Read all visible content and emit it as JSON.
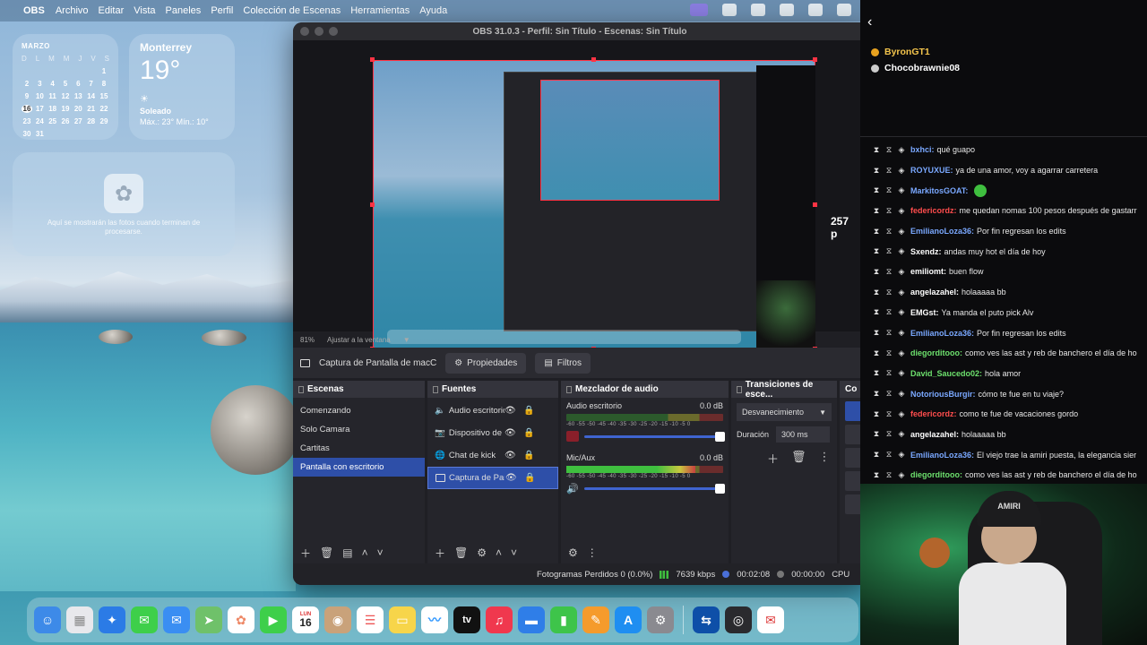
{
  "menubar": {
    "apple": "",
    "app_name": "OBS",
    "items": [
      "Archivo",
      "Editar",
      "Vista",
      "Paneles",
      "Perfil",
      "Colección de Escenas",
      "Herramientas",
      "Ayuda"
    ]
  },
  "calendar_widget": {
    "month": "MARZO",
    "weekdays": [
      "D",
      "L",
      "M",
      "M",
      "J",
      "V",
      "S"
    ],
    "weeks": [
      [
        "",
        "",
        "",
        "",
        "",
        "",
        "1"
      ],
      [
        "2",
        "3",
        "4",
        "5",
        "6",
        "7",
        "8"
      ],
      [
        "9",
        "10",
        "11",
        "12",
        "13",
        "14",
        "15"
      ],
      [
        "16",
        "17",
        "18",
        "19",
        "20",
        "21",
        "22"
      ],
      [
        "23",
        "24",
        "25",
        "26",
        "27",
        "28",
        "29"
      ],
      [
        "30",
        "31",
        "",
        "",
        "",
        "",
        ""
      ]
    ],
    "today": "16"
  },
  "weather_widget": {
    "city": "Monterrey",
    "temp": "19°",
    "condition": "Soleado",
    "range": "Máx.: 23° Mín.: 10°"
  },
  "photos_widget": {
    "text": "Aquí se mostrarán las fotos cuando terminan de procesarse."
  },
  "obs": {
    "title": "OBS 31.0.3 - Perfil: Sin Título - Escenas: Sin Título",
    "preview_overlay_number": "257 p",
    "zoom": {
      "percent": "81%",
      "fit_label": "Ajustar a la ventana"
    },
    "source_toolbar": {
      "source_name": "Captura de Pantalla de macC",
      "properties": "Propiedades",
      "filters": "Filtros"
    },
    "scenes": {
      "title": "Escenas",
      "items": [
        "Comenzando",
        "Solo Camara",
        "Cartitas",
        "Pantalla con escritorio"
      ],
      "selected_index": 3
    },
    "sources": {
      "title": "Fuentes",
      "items": [
        {
          "label": "Audio escritorio",
          "icon": "speaker-icon"
        },
        {
          "label": "Dispositivo de c",
          "icon": "camera-icon"
        },
        {
          "label": "Chat de kick",
          "icon": "browser-icon"
        },
        {
          "label": "Captura de Pan",
          "icon": "monitor-icon"
        }
      ],
      "selected_index": 3
    },
    "mixer": {
      "title": "Mezclador de audio",
      "scale": "-60 -55 -50 -45 -40 -35 -30 -25 -20 -15 -10 -5 0",
      "channels": [
        {
          "name": "Audio escritorio",
          "db": "0.0 dB",
          "level": 0,
          "muted": true
        },
        {
          "name": "Mic/Aux",
          "db": "0.0 dB",
          "level": 0.82,
          "muted": false
        }
      ]
    },
    "transitions": {
      "title": "Transiciones de esce...",
      "type": "Desvanecimiento",
      "duration_label": "Duración",
      "duration_value": "300 ms"
    },
    "controls": {
      "title": "Co"
    },
    "status": {
      "dropped": "Fotogramas Perdidos 0 (0.0%)",
      "bitrate": "7639 kbps",
      "stream_time": "00:02:08",
      "rec_time": "00:00:00",
      "cpu": "CPU"
    }
  },
  "dock": {
    "calendar_day": "16",
    "calendar_month": "LUN",
    "apps": [
      "finder-icon",
      "launchpad-icon",
      "safari-icon",
      "messages-icon",
      "mail-icon",
      "maps-icon",
      "photos-icon",
      "facetime-icon",
      "calendar-icon",
      "contacts-icon",
      "reminders-icon",
      "notes-icon",
      "freeform-icon",
      "appletv-icon",
      "music-icon",
      "keynote-icon",
      "numbers-icon",
      "pages-icon",
      "appstore-icon",
      "settings-icon",
      "teamviewer-icon",
      "obs-icon",
      "airmail-icon"
    ]
  },
  "chat": {
    "pinned": [
      {
        "user": "ByronGT1",
        "color": "#f3c44c"
      },
      {
        "user": "Chocobrawnie08",
        "color": "#ffffff"
      }
    ],
    "messages": [
      {
        "user": "bxhci",
        "color": "#7aa8ff",
        "text": "qué guapo",
        "emote": false
      },
      {
        "user": "ROYUXUE",
        "color": "#7aa8ff",
        "text": "ya de una amor, voy a agarrar carretera",
        "emote": false
      },
      {
        "user": "MarkitosGOAT",
        "color": "#7aa8ff",
        "text": "",
        "emote": true
      },
      {
        "user": "federicordz",
        "color": "#ff4d4d",
        "text": "me quedan nomas 100 pesos después de gastarr",
        "emote": false
      },
      {
        "user": "EmilianoLoza36",
        "color": "#7aa8ff",
        "text": "Por fin regresan los edits",
        "emote": false
      },
      {
        "user": "Sxendz",
        "color": "#ffffff",
        "text": "andas muy hot el día de hoy",
        "emote": false
      },
      {
        "user": "emiliomt",
        "color": "#ffffff",
        "text": "buen flow",
        "emote": false
      },
      {
        "user": "angelazahel",
        "color": "#ffffff",
        "text": "holaaaaa bb",
        "emote": false
      },
      {
        "user": "EMGst",
        "color": "#ffffff",
        "text": "Ya manda el puto pick Alv",
        "emote": false
      },
      {
        "user": "EmilianoLoza36",
        "color": "#7aa8ff",
        "text": "Por fin regresan los edits",
        "emote": false
      },
      {
        "user": "diegorditooo",
        "color": "#6de06d",
        "text": "como ves las ast y reb de banchero el día de ho",
        "emote": false
      },
      {
        "user": "David_Saucedo02",
        "color": "#6de06d",
        "text": "hola amor",
        "emote": false
      },
      {
        "user": "NotoriousBurgir",
        "color": "#7aa8ff",
        "text": "cómo te fue en tu viaje?",
        "emote": false
      },
      {
        "user": "federicordz",
        "color": "#ff4d4d",
        "text": "como te fue de vacaciones gordo",
        "emote": false
      },
      {
        "user": "angelazahel",
        "color": "#ffffff",
        "text": "holaaaaa bb",
        "emote": false
      },
      {
        "user": "EmilianoLoza36",
        "color": "#7aa8ff",
        "text": "El viejo trae la amiri puesta, la elegancia sier",
        "emote": false
      },
      {
        "user": "diegorditooo",
        "color": "#6de06d",
        "text": "como ves las ast y reb de banchero el día de ho",
        "emote": false
      }
    ]
  },
  "webcam": {
    "cap_text": "AMIRI"
  }
}
